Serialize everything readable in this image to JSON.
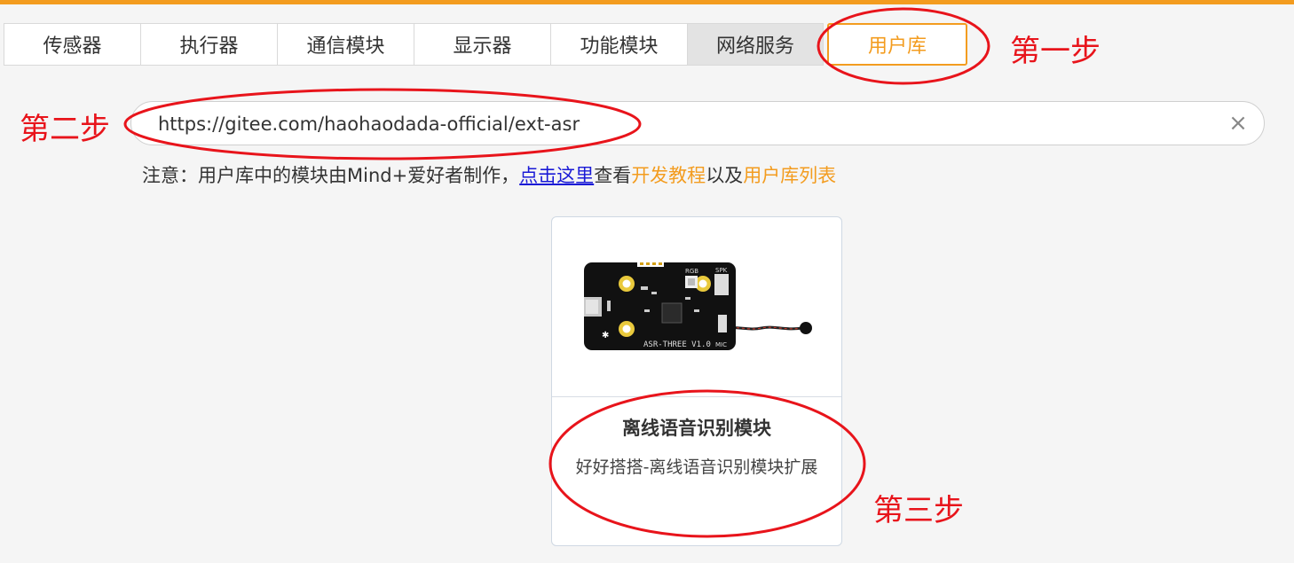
{
  "tabs": [
    {
      "label": "传感器"
    },
    {
      "label": "执行器"
    },
    {
      "label": "通信模块"
    },
    {
      "label": "显示器"
    },
    {
      "label": "功能模块"
    },
    {
      "label": "网络服务"
    },
    {
      "label": "用户库"
    }
  ],
  "active_tab": "用户库",
  "search": {
    "value": "https://gitee.com/haohaodada-official/ext-asr",
    "clear_icon": "close-icon"
  },
  "notice": {
    "prefix": "注意：用户库中的模块由Mind+爱好者制作，",
    "link": "点击这里",
    "middle": "查看",
    "tutorial": "开发教程",
    "and": "以及",
    "list": "用户库列表"
  },
  "card": {
    "title": "离线语音识别模块",
    "description": "好好搭搭-离线语音识别模块扩展",
    "board_label": "ASR-THREE V1.0",
    "label_rgb": "RGB",
    "label_spk": "SPK",
    "label_mic": "MIC"
  },
  "annotations": {
    "step1": "第一步",
    "step2": "第二步",
    "step3": "第三步"
  },
  "colors": {
    "accent": "#f39c1f",
    "annotation": "#e8141b",
    "link": "#1a1ad6"
  }
}
